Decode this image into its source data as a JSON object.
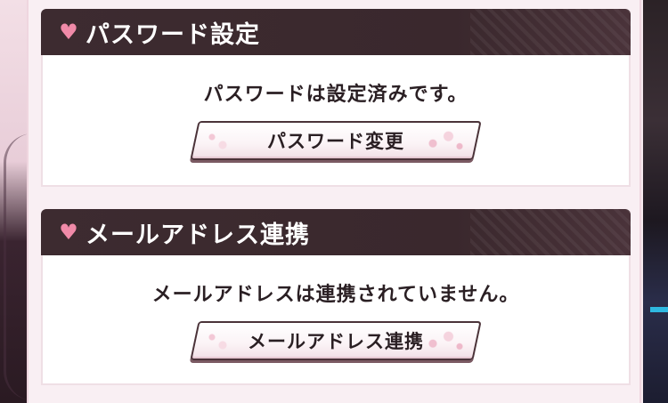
{
  "sections": [
    {
      "icon": "heart-icon",
      "title": "パスワード設定",
      "status": "パスワードは設定済みです。",
      "button_label": "パスワード変更"
    },
    {
      "icon": "heart-icon",
      "title": "メールアドレス連携",
      "status": "メールアドレスは連携されていません。",
      "button_label": "メールアドレス連携"
    }
  ],
  "colors": {
    "header_bg": "#3d2b30",
    "accent_heart": "#f08aa8",
    "panel_bg": "#f9eff3"
  }
}
